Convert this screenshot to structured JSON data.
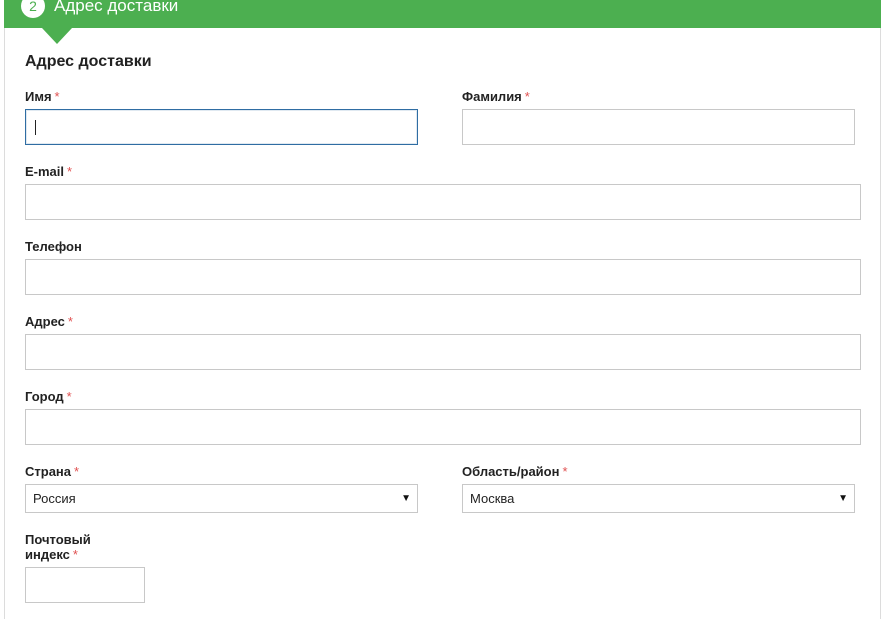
{
  "step": {
    "number": "2",
    "title": "Адрес доставки"
  },
  "section_title": "Адрес доставки",
  "required_mark": "*",
  "fields": {
    "first_name": {
      "label": "Имя",
      "value": ""
    },
    "last_name": {
      "label": "Фамилия",
      "value": ""
    },
    "email": {
      "label": "E-mail",
      "value": ""
    },
    "phone": {
      "label": "Телефон",
      "value": ""
    },
    "address": {
      "label": "Адрес",
      "value": ""
    },
    "city": {
      "label": "Город",
      "value": ""
    },
    "country": {
      "label": "Страна",
      "selected": "Россия"
    },
    "region": {
      "label": "Область/район",
      "selected": "Москва"
    },
    "postcode": {
      "label_line1": "Почтовый",
      "label_line2": "индекс",
      "value": ""
    }
  },
  "icons": {
    "dropdown": "▼"
  },
  "colors": {
    "accent": "#4caf50",
    "required": "#e05050",
    "focus_border": "#2f6da3"
  }
}
